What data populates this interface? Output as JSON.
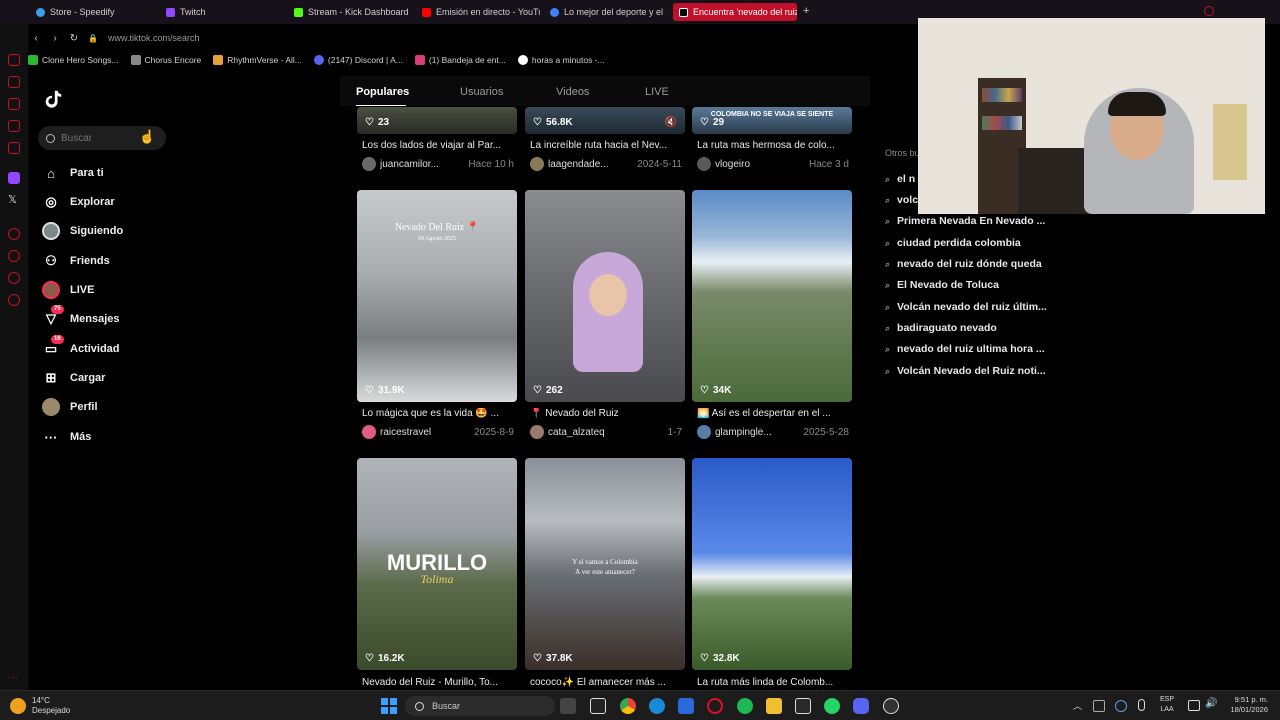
{
  "browser": {
    "tabs": [
      {
        "label": "Store - Speedify",
        "color": "#3aa0e8"
      },
      {
        "label": "Twitch",
        "color": "#9146ff"
      },
      {
        "label": "Stream - Kick Dashboard",
        "color": "#53fc18"
      },
      {
        "label": "Emisión en directo - YouTu",
        "color": "#ff0000"
      },
      {
        "label": "Lo mejor del deporte y el e",
        "color": "#3b82f6"
      },
      {
        "label": "Encuentra 'nevado del ruiz",
        "color": "#000000"
      }
    ],
    "add_tab": "+",
    "url": "www.tiktok.com/search",
    "bookmarks": [
      {
        "label": "Clone Hero Songs...",
        "color": "#2eb82e"
      },
      {
        "label": "Chorus Encore",
        "color": "#888888"
      },
      {
        "label": "RhythmVerse - All...",
        "color": "#e8a23a"
      },
      {
        "label": "(2147) Discord | A...",
        "color": "#5865f2"
      },
      {
        "label": "(1) Bandeja de ent...",
        "color": "#d93d7a"
      },
      {
        "label": "horas a minutos -...",
        "color": "#ffffff"
      }
    ]
  },
  "tiktok": {
    "search_placeholder": "Buscar",
    "nav": [
      {
        "label": "Para ti",
        "icon": "home-icon"
      },
      {
        "label": "Explorar",
        "icon": "compass-icon"
      },
      {
        "label": "Siguiendo",
        "icon": "following-icon"
      },
      {
        "label": "Friends",
        "icon": "friends-icon"
      },
      {
        "label": "LIVE",
        "icon": "live-icon"
      },
      {
        "label": "Mensajes",
        "icon": "messages-icon",
        "badge": "75"
      },
      {
        "label": "Actividad",
        "icon": "activity-icon",
        "badge": "16"
      },
      {
        "label": "Cargar",
        "icon": "upload-icon"
      },
      {
        "label": "Perfil",
        "icon": "profile-icon"
      },
      {
        "label": "Más",
        "icon": "more-icon"
      }
    ],
    "tabs": [
      "Populares",
      "Usuarios",
      "Videos",
      "LIVE"
    ],
    "videos": [
      {
        "likes": "23",
        "caption": "Los dos lados de viajar al Par...",
        "user": "juancamilor...",
        "time": "Hace 10 h",
        "palette": [
          "#4a5040",
          "#2a2a28"
        ]
      },
      {
        "likes": "56.8K",
        "caption": "La increíble ruta hacia el Nev...",
        "user": "laagendade...",
        "time": "2024-5-11",
        "palette": [
          "#3a4a5a",
          "#1e2a33"
        ]
      },
      {
        "likes": "29",
        "caption": "La ruta mas hermosa de colo...",
        "user": "vlogeiro",
        "time": "Hace 3 d",
        "overlay": "COLOMBIA NO SE VIAJA SE SIENTE",
        "palette": [
          "#5a7a9a",
          "#2a3a4a"
        ]
      },
      {
        "likes": "31.9K",
        "caption": "Lo mágica que es la vida 🤩 ...",
        "user": "raicestravel",
        "time": "2025-8-9",
        "overlay": "Nevado Del Ruiz 📍",
        "overlay2": "09 Agosto 2025",
        "palette": [
          "#b8bcc0",
          "#6a6e70"
        ]
      },
      {
        "likes": "262",
        "caption": "📍 Nevado del Ruiz",
        "user": "cata_alzateq",
        "time": "1-7",
        "palette": [
          "#7a7a7e",
          "#4e4e52"
        ]
      },
      {
        "likes": "34K",
        "caption": "🌅 Así es el despertar en el ...",
        "user": "glampingle...",
        "time": "2025-5-28",
        "palette": [
          "#5a8ac8",
          "#4a6a3a"
        ]
      },
      {
        "likes": "16.2K",
        "caption": "Nevado del Ruiz - Murillo, To...",
        "user": "",
        "time": "",
        "overlay": "MURILLO",
        "overlay2": "Tolima",
        "palette": [
          "#a0a4a8",
          "#4a5a3a"
        ]
      },
      {
        "likes": "37.8K",
        "caption": "cococo✨ El amanecer más ...",
        "user": "",
        "time": "",
        "overlay": "Y si vamos a Colombia",
        "overlay2": "A ver este amanecer?",
        "palette": [
          "#6a7078",
          "#3a2e2a"
        ]
      },
      {
        "likes": "32.8K",
        "caption": "La ruta más linda de Colomb...",
        "user": "",
        "time": "",
        "palette": [
          "#3a6ac8",
          "#3a5a2a"
        ]
      }
    ],
    "others_title": "Otros buscaron",
    "suggestions": [
      "el n",
      "volc",
      "Primera Nevada En Nevado ...",
      "ciudad perdida colombia",
      "nevado del ruiz dónde queda",
      "El Nevado de Toluca",
      "Volcán nevado del ruiz últim...",
      "badiraguato nevado",
      "nevado del ruiz ultima hora ...",
      "Volcán Nevado del Ruiz noti..."
    ]
  },
  "taskbar": {
    "weather_temp": "14°C",
    "weather_desc": "Despejado",
    "search_label": "Buscar",
    "lang_1": "ESP",
    "lang_2": "LAA",
    "time": "9:51 p. m.",
    "date": "18/01/2026"
  }
}
